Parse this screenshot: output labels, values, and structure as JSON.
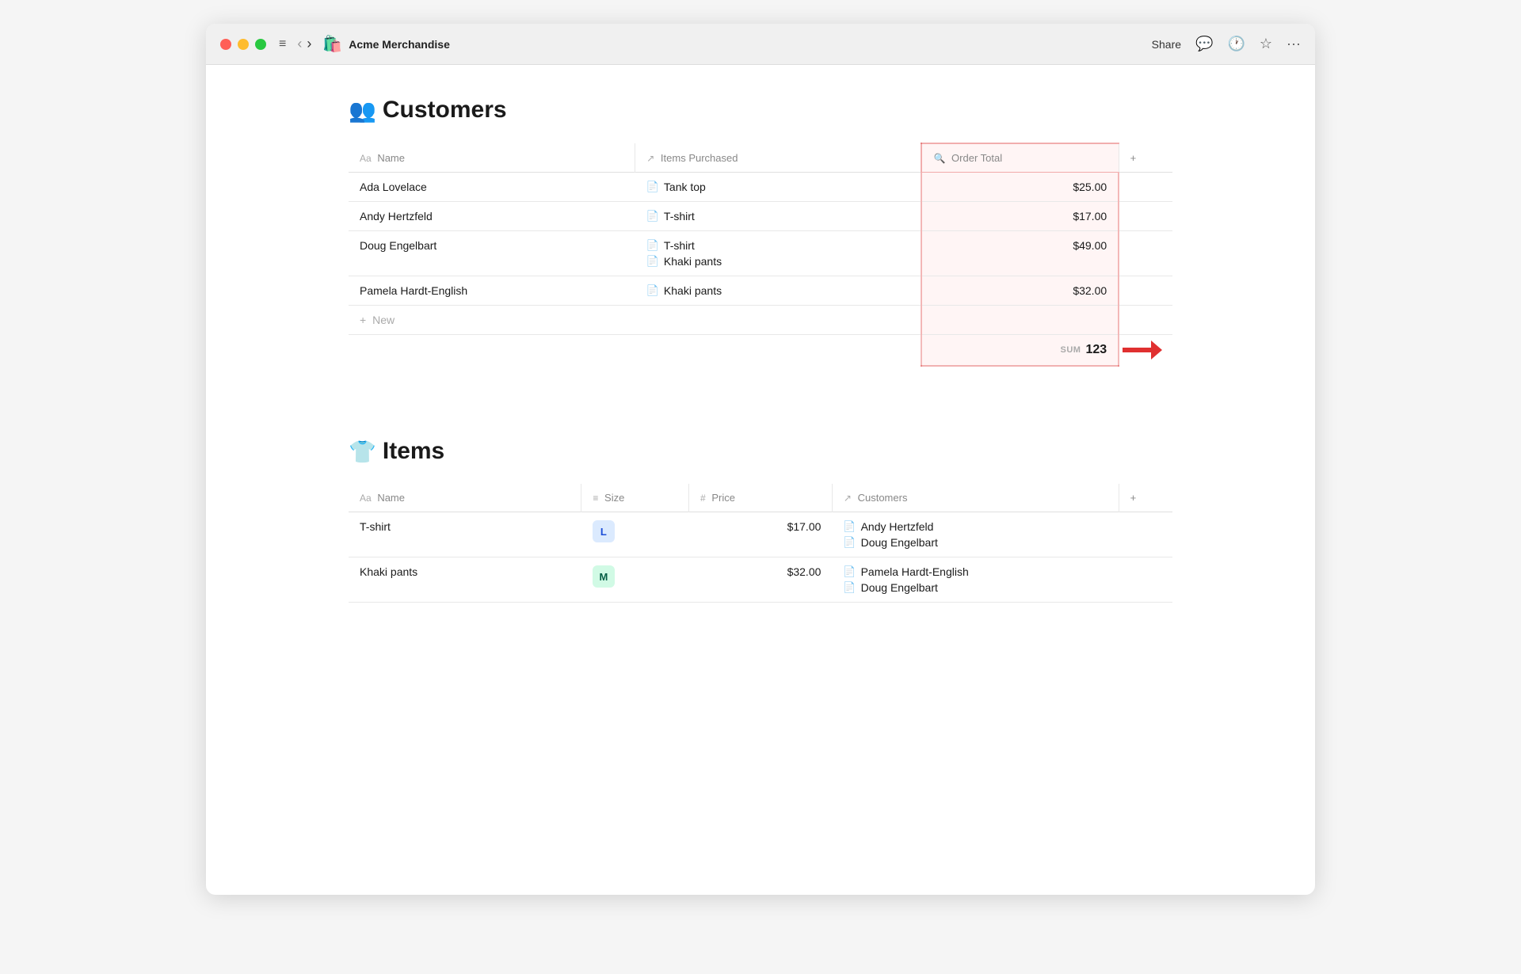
{
  "titlebar": {
    "app_icon": "🛍️",
    "app_title": "Acme Merchandise",
    "share_label": "Share",
    "icons": {
      "comment": "💬",
      "history": "🕐",
      "star": "☆",
      "more": "···"
    }
  },
  "customers_section": {
    "icon": "👥",
    "title": "Customers",
    "columns": {
      "name": "Name",
      "items_purchased": "Items Purchased",
      "order_total": "Order Total",
      "add": "+"
    },
    "rows": [
      {
        "name": "Ada Lovelace",
        "items": [
          "Tank top"
        ],
        "order_total": "$25.00"
      },
      {
        "name": "Andy Hertzfeld",
        "items": [
          "T-shirt"
        ],
        "order_total": "$17.00"
      },
      {
        "name": "Doug Engelbart",
        "items": [
          "T-shirt",
          "Khaki pants"
        ],
        "order_total": "$49.00"
      },
      {
        "name": "Pamela Hardt-English",
        "items": [
          "Khaki pants"
        ],
        "order_total": "$32.00"
      }
    ],
    "new_row_label": "New",
    "sum_label": "SUM",
    "sum_value": "123"
  },
  "items_section": {
    "icon": "👕",
    "title": "Items",
    "columns": {
      "name": "Name",
      "size": "Size",
      "price": "Price",
      "customers": "Customers",
      "add": "+"
    },
    "rows": [
      {
        "name": "T-shirt",
        "size": "L",
        "size_class": "size-L",
        "price": "$17.00",
        "customers": [
          "Andy Hertzfeld",
          "Doug Engelbart"
        ]
      },
      {
        "name": "Khaki pants",
        "size": "M",
        "size_class": "size-M",
        "price": "$32.00",
        "customers": [
          "Pamela Hardt-English",
          "Doug Engelbart"
        ]
      }
    ]
  }
}
